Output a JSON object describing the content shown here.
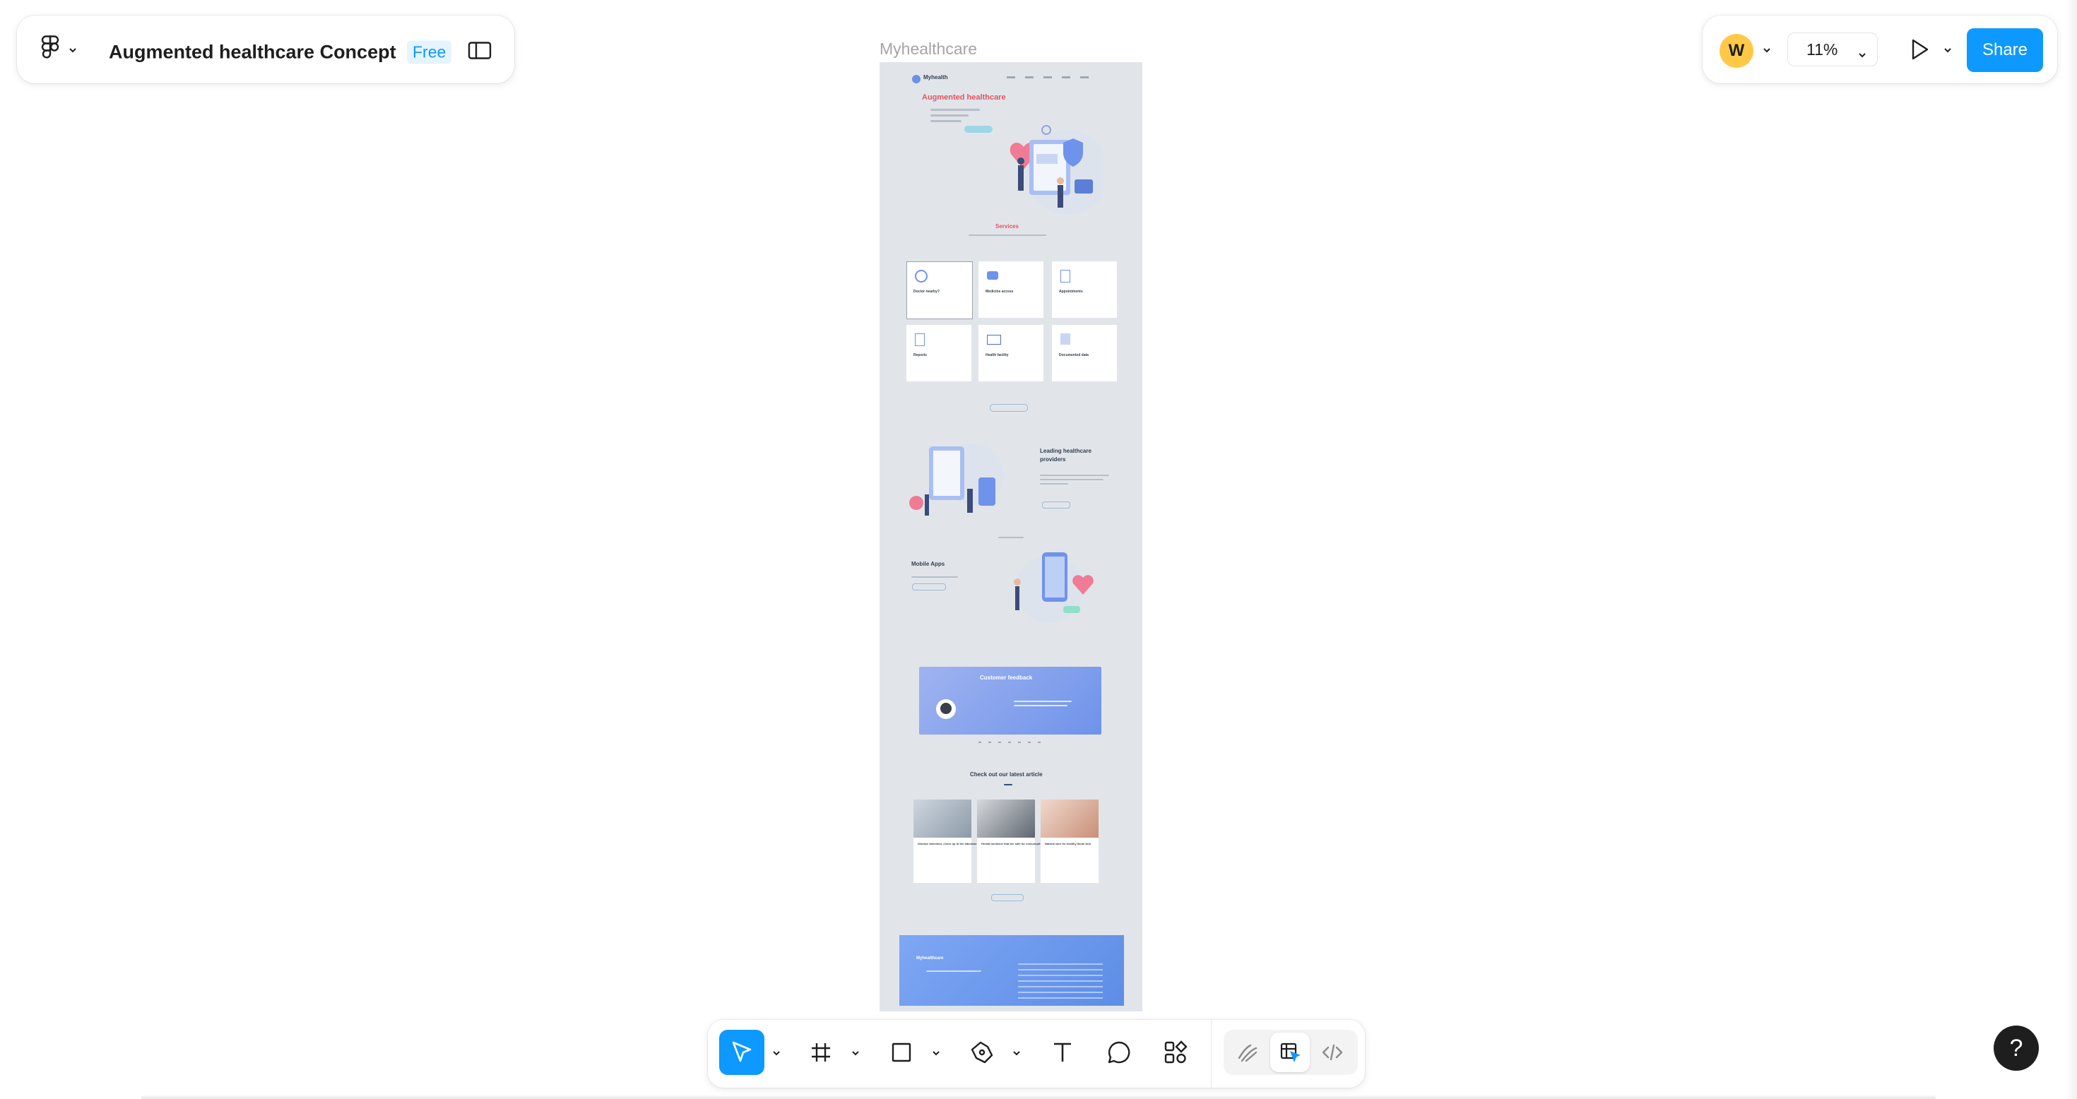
{
  "file": {
    "title": "Augmented healthcare Concept",
    "plan": "Free"
  },
  "canvas": {
    "frame_label": "Myhealthcare",
    "frame": {
      "brand": "Myhealth",
      "hero_title": "Augmented healthcare",
      "services_title": "Services",
      "service_cards": [
        {
          "title": "Doctor nearby?",
          "icon": "search-doctor-icon"
        },
        {
          "title": "Medicine access",
          "icon": "pill-icon"
        },
        {
          "title": "Appointments",
          "icon": "calendar-doc-icon"
        },
        {
          "title": "Reports",
          "icon": "report-icon"
        },
        {
          "title": "Health facility",
          "icon": "hospital-icon"
        },
        {
          "title": "Documented data",
          "icon": "document-icon"
        }
      ],
      "providers_title_1": "Leading healthcare",
      "providers_title_2": "providers",
      "mobile_title": "Mobile Apps",
      "feedback_title": "Customer feedback",
      "articles_title": "Check out our latest article",
      "articles": [
        {
          "title": "Disease detection, check up in the laboratory"
        },
        {
          "title": "Herbal medicine that are safe for consumption"
        },
        {
          "title": "Natural care for healthy facial skin"
        }
      ],
      "footer_brand": "Myhealthcare"
    }
  },
  "zoom": {
    "value": "11%"
  },
  "user": {
    "initial": "W"
  },
  "actions": {
    "share": "Share"
  },
  "help": {
    "label": "?"
  },
  "colors": {
    "accent": "#0d99ff",
    "share": "#0d99ff",
    "avatar": "#ffc947",
    "hero_title": "#e3545f",
    "frame_bg": "#e1e5ea"
  }
}
